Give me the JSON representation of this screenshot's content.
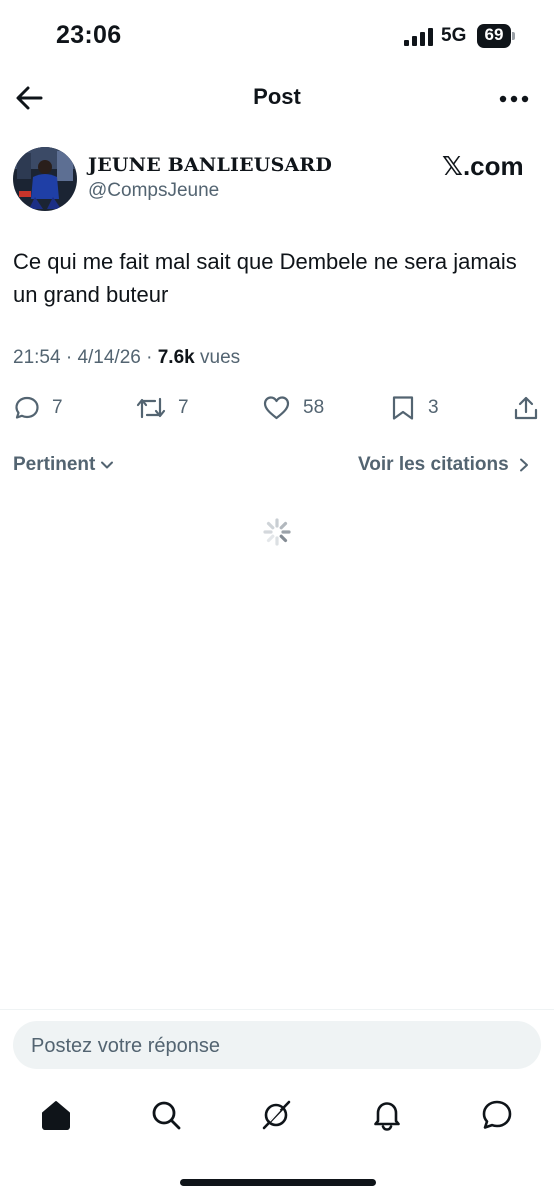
{
  "status_bar": {
    "time": "23:06",
    "network": "5G",
    "battery": "69"
  },
  "header": {
    "title": "Post",
    "back_icon": "arrow-left-icon",
    "more_icon": "more-horizontal-icon"
  },
  "author": {
    "display_name": "JEUNE BANLIEUSARD",
    "handle": "@CompsJeune",
    "watermark": "𝕏.com"
  },
  "tweet": {
    "text": "Ce qui me fait mal sait que Dembele ne sera jamais un grand buteur",
    "time": "21:54",
    "date": "4/14/26",
    "views_count": "7.6k",
    "views_label": "vues"
  },
  "actions": {
    "replies": "7",
    "reposts": "7",
    "likes": "58",
    "bookmarks": "3"
  },
  "filters": {
    "sort_label": "Pertinent",
    "quotes_label": "Voir les citations"
  },
  "reply": {
    "placeholder": "Postez votre réponse"
  },
  "tab_bar": {
    "items": [
      "home-icon",
      "search-icon",
      "grok-icon",
      "notifications-icon",
      "messages-icon"
    ]
  },
  "colors": {
    "text": "#0f1419",
    "secondary": "#536471",
    "input_bg": "#eff3f4"
  }
}
